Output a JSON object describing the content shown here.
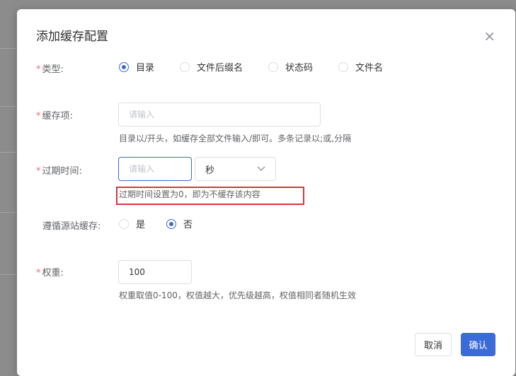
{
  "dialog": {
    "title": "添加缓存配置",
    "close_icon": "×"
  },
  "form": {
    "type": {
      "label": "类型:",
      "options": [
        "目录",
        "文件后缀名",
        "状态码",
        "文件名"
      ],
      "selected": "目录"
    },
    "cache_item": {
      "label": "缓存项:",
      "placeholder": "请输入",
      "value": "",
      "hint": "目录以/开头，如缓存全部文件输入/即可。多条记录以;或,分隔"
    },
    "expire_time": {
      "label": "过期时间:",
      "placeholder": "请输入",
      "value": "",
      "unit": "秒",
      "hint": "过期时间设置为0，即为不缓存该内容"
    },
    "follow_origin": {
      "label": "遵循源站缓存:",
      "options": [
        "是",
        "否"
      ],
      "selected": "否"
    },
    "weight": {
      "label": "权重:",
      "value": "100",
      "hint": "权重取值0-100，权值越大，优先级越高，权值相同者随机生效"
    }
  },
  "footer": {
    "cancel_label": "取消",
    "confirm_label": "确认"
  },
  "colors": {
    "primary": "#3b6bd7",
    "required_star": "#f56c6c",
    "highlight_box": "#d9363e",
    "overlay": "#8c8c8c"
  },
  "icons": {
    "close": "close-icon",
    "dropdown": "chevron-down-icon"
  }
}
